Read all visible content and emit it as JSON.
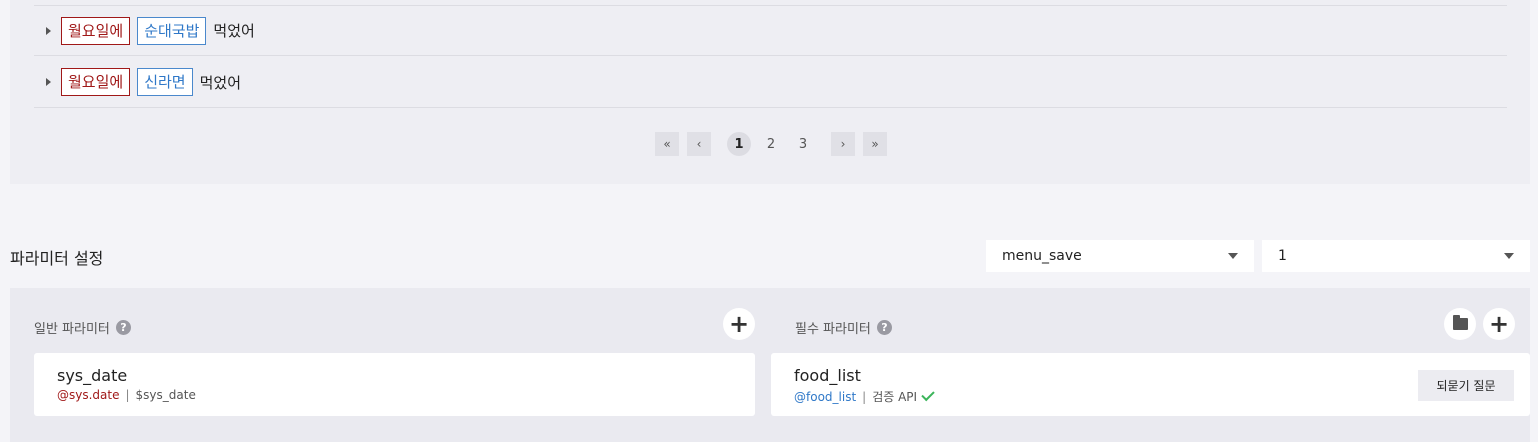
{
  "examples": [
    {
      "tag1": "월요일에",
      "tag2": "순대국밥",
      "text": "먹었어"
    },
    {
      "tag1": "월요일에",
      "tag2": "신라면",
      "text": "먹었어"
    }
  ],
  "pagination": {
    "first": "«",
    "prev": "‹",
    "pages": [
      "1",
      "2",
      "3"
    ],
    "current": "1",
    "next": "›",
    "last": "»"
  },
  "params": {
    "title": "파라미터 설정",
    "select1": "menu_save",
    "select2": "1",
    "general": {
      "label": "일반 파라미터",
      "help": "?",
      "add": "+",
      "item": {
        "name": "sys_date",
        "key": "@sys.date",
        "sep": "|",
        "value": "$sys_date"
      }
    },
    "required": {
      "label": "필수 파라미터",
      "help": "?",
      "add": "+",
      "item": {
        "name": "food_list",
        "key": "@food_list",
        "sep": "|",
        "value": "검증 API",
        "button": "되묻기 질문"
      }
    }
  },
  "colors": {
    "tag_red": "#a01818",
    "tag_blue": "#2f78c8",
    "check_green": "#3cb55b"
  }
}
